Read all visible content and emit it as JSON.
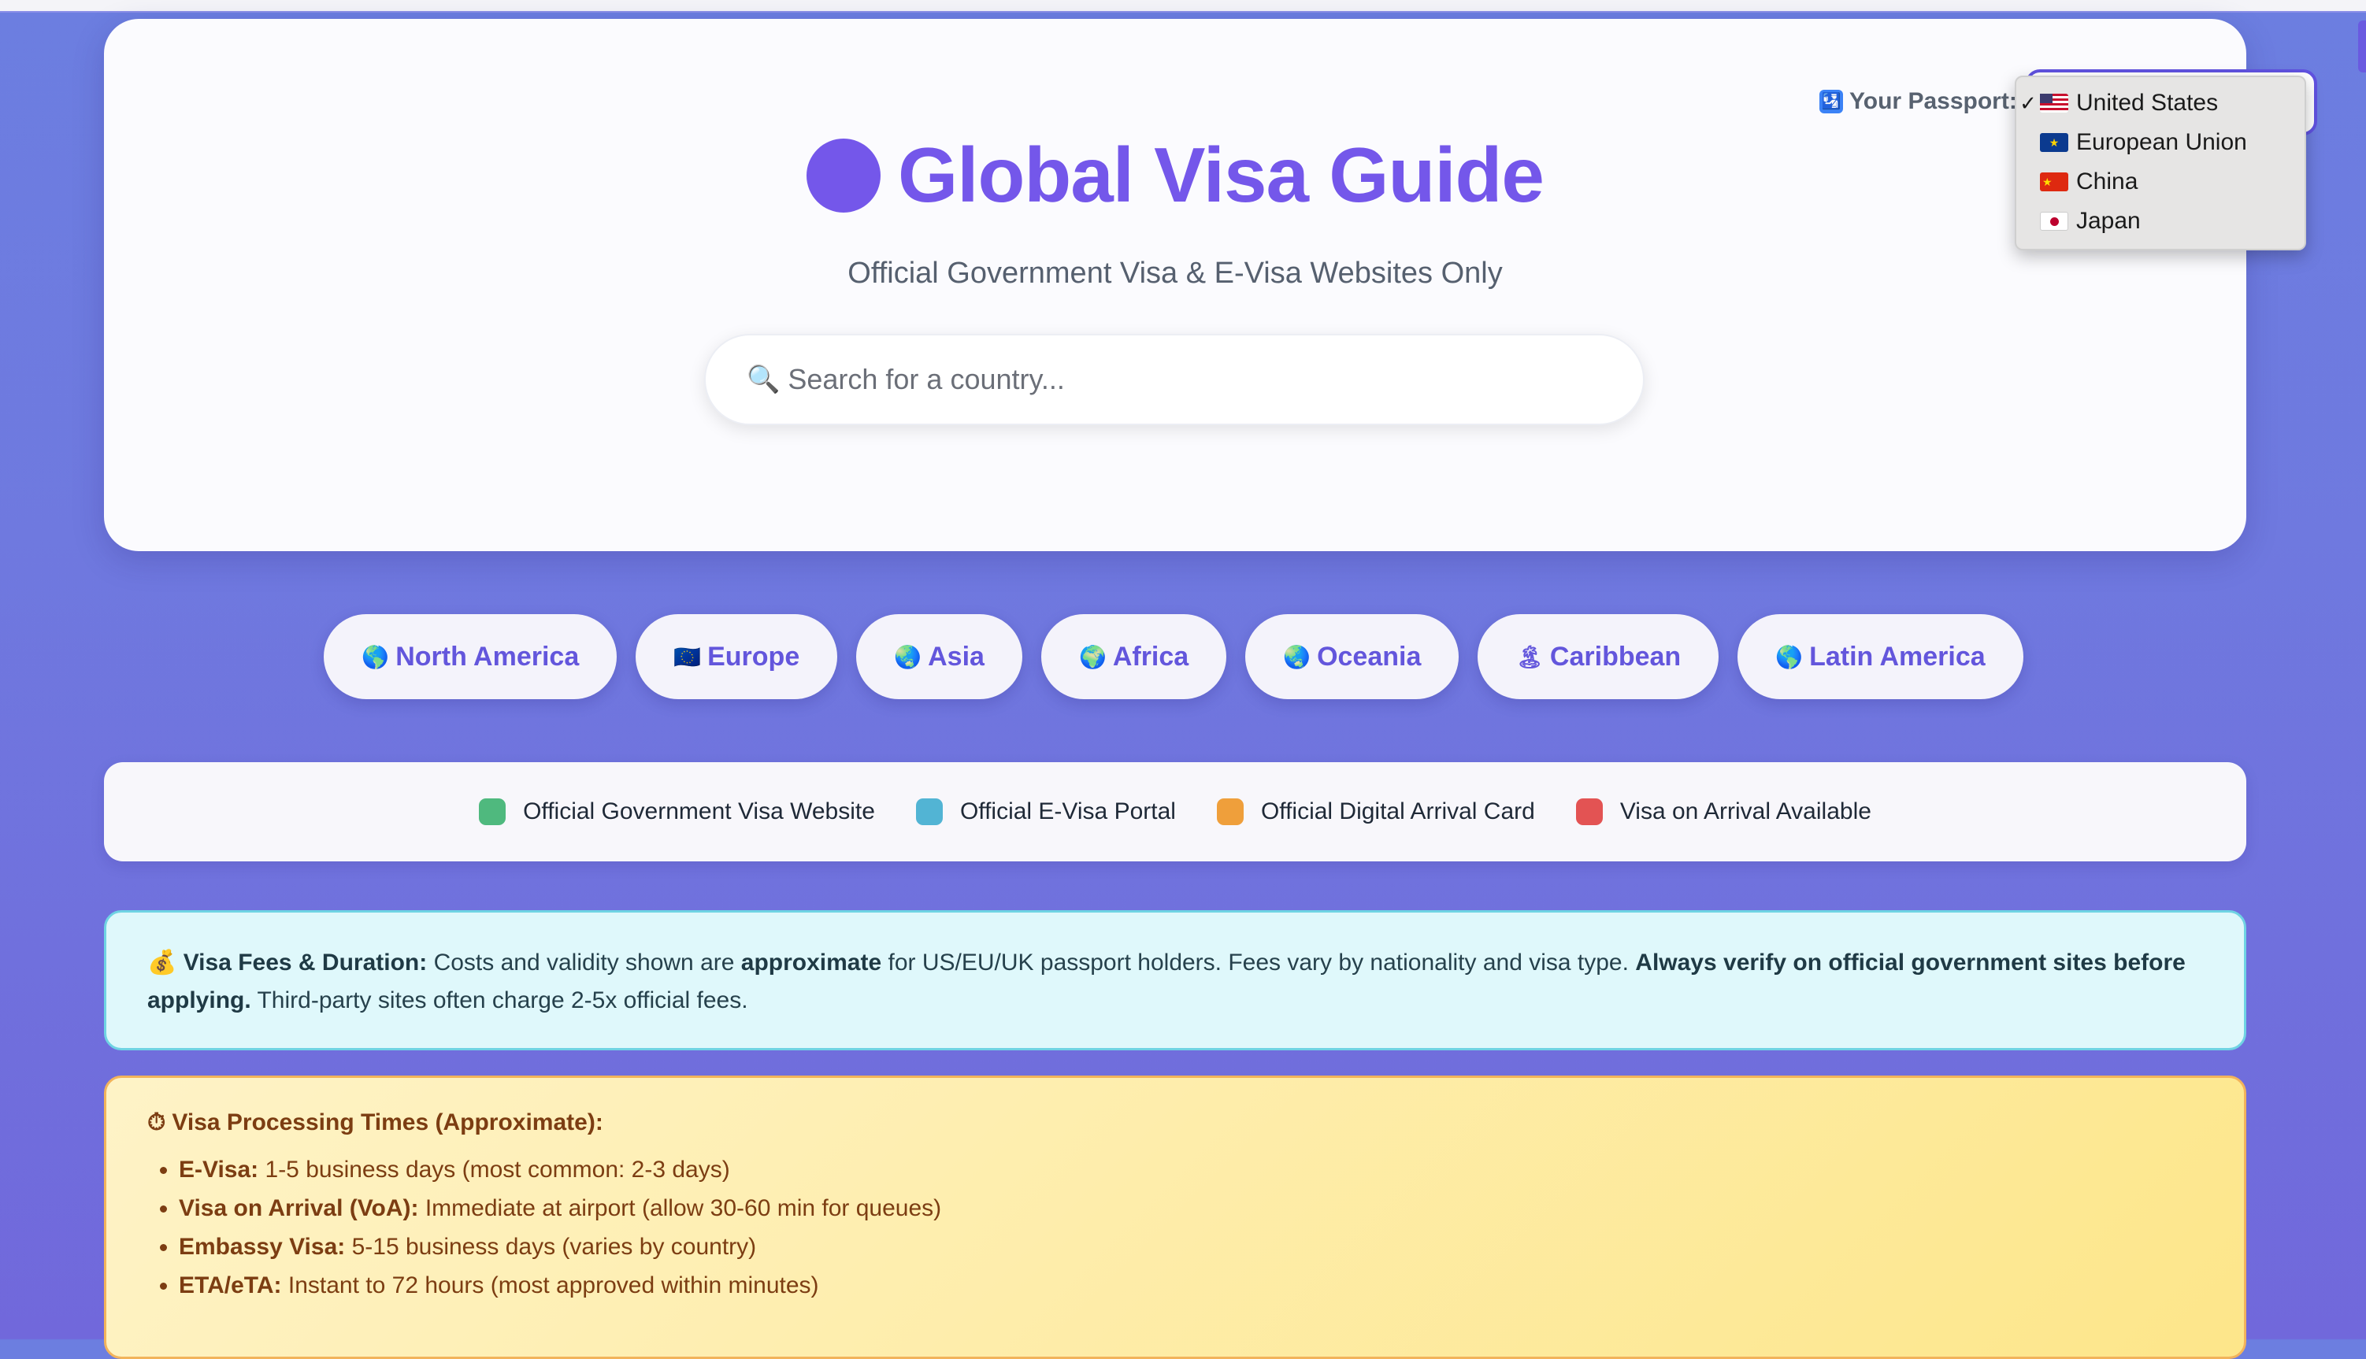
{
  "header": {
    "title": "Global Visa Guide",
    "subtitle": "Official Government Visa & E-Visa Websites Only",
    "search_placeholder": "Search for a country...",
    "passport_label": "Your Passport:",
    "passport_options": [
      {
        "label": "United States",
        "selected": true
      },
      {
        "label": "European Union",
        "selected": false
      },
      {
        "label": "China",
        "selected": false
      },
      {
        "label": "Japan",
        "selected": false
      }
    ],
    "accent_color": "#7457ea"
  },
  "regions": [
    {
      "label": "North America",
      "icon": "globe-americas-icon"
    },
    {
      "label": "Europe",
      "icon": "eu-flag-icon"
    },
    {
      "label": "Asia",
      "icon": "globe-asia-icon"
    },
    {
      "label": "Africa",
      "icon": "globe-africa-icon"
    },
    {
      "label": "Oceania",
      "icon": "globe-asia-icon"
    },
    {
      "label": "Caribbean",
      "icon": "island-icon"
    },
    {
      "label": "Latin America",
      "icon": "globe-americas-icon"
    }
  ],
  "legend": [
    {
      "label": "Official Government Visa Website",
      "color": "#4fb97e"
    },
    {
      "label": "Official E-Visa Portal",
      "color": "#52b4d4"
    },
    {
      "label": "Official Digital Arrival Card",
      "color": "#ef9f3b"
    },
    {
      "label": "Visa on Arrival Available",
      "color": "#e35353"
    }
  ],
  "fees": {
    "heading": "Visa Fees & Duration:",
    "text1": " Costs and validity shown are ",
    "bold1": "approximate",
    "text2": " for US/EU/UK passport holders. Fees vary by nationality and visa type. ",
    "bold2": "Always verify on official government sites before applying.",
    "text3": " Third-party sites often charge 2-5x official fees."
  },
  "processing": {
    "title": "Visa Processing Times (Approximate):",
    "items": [
      {
        "label": "E-Visa:",
        "text": " 1-5 business days (most common: 2-3 days)"
      },
      {
        "label": "Visa on Arrival (VoA):",
        "text": " Immediate at airport (allow 30-60 min for queues)"
      },
      {
        "label": "Embassy Visa:",
        "text": " 5-15 business days (varies by country)"
      },
      {
        "label": "ETA/eTA:",
        "text": " Instant to 72 hours (most approved within minutes)"
      }
    ]
  }
}
